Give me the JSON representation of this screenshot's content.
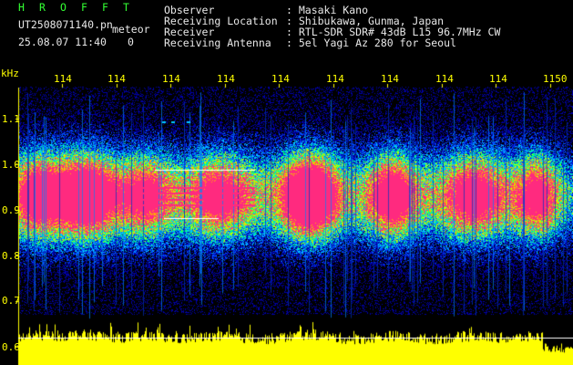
{
  "header": {
    "title_letters": [
      "H",
      "R",
      "O",
      "F",
      "F",
      "T"
    ],
    "filename": "UT2508071140.pn",
    "mode": "meteor",
    "datetime": "25.08.07 11:40",
    "count": "0",
    "meta_labels": [
      "Observer",
      "Receiving Location",
      "Receiver",
      "Receiving Antenna"
    ],
    "meta_values": [
      ": Masaki Kano",
      ": Shibukawa, Gunma, Japan",
      ": RTL-SDR SDR# 43dB L15 96.7MHz CW",
      ": 5el Yagi Az 280 for Seoul"
    ]
  },
  "axis": {
    "y_unit": "kHz",
    "y_ticks": [
      "1.1",
      "1.0",
      "0.9",
      "0.8",
      "0.7",
      "0.6"
    ],
    "x_ticks": [
      "114",
      "114",
      "114",
      "114",
      "114",
      "114",
      "114",
      "114",
      "114",
      "1150"
    ]
  },
  "colors": {
    "echo": "#ff2a7f",
    "noise_low": "#0000a0",
    "noise_mid": "#00c0ff",
    "noise_high": "#00ff60",
    "spectrum": "#ffff00",
    "tick": "#ffff00"
  }
}
